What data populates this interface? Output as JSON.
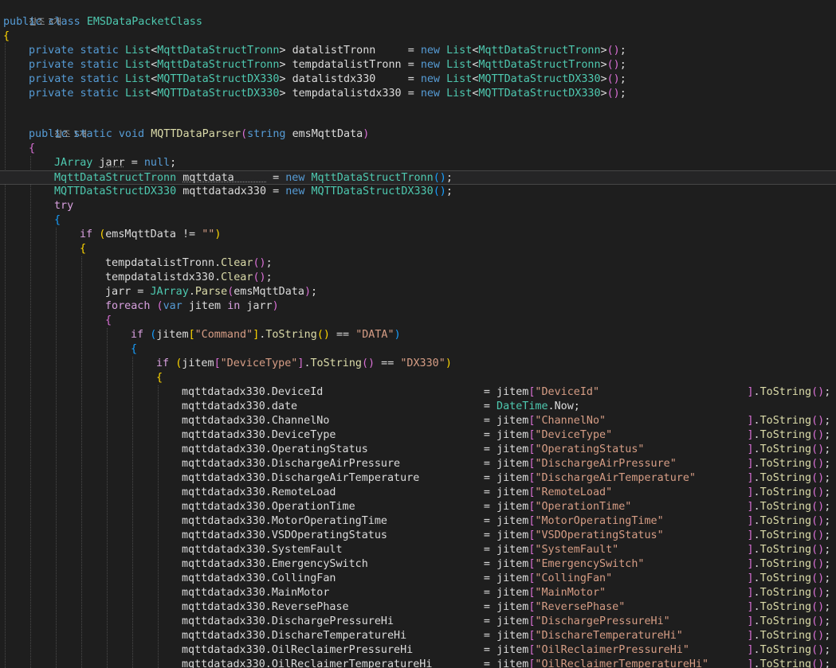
{
  "colors": {
    "background": "#1e1e1e",
    "keyword": "#569cd6",
    "control_keyword": "#d8a0df",
    "type": "#4ec9b0",
    "method": "#dcdcaa",
    "string": "#d69d85",
    "identifier": "#dcdcdc",
    "codelens": "#a0a0a0",
    "brace_level1": "#ffd700",
    "brace_level2": "#da70d6",
    "brace_level3": "#179fff"
  },
  "codelens": {
    "class_refs": "참조 3개",
    "method_refs": "참조 1개"
  },
  "code": {
    "class_decl": {
      "public": "public",
      "class": "class",
      "name": "EMSDataPacketClass"
    },
    "fields": [
      {
        "mods": "private static",
        "type": "List",
        "generic": "MqttDataStructTronn",
        "name": "datalistTronn     ",
        "new": "new",
        "init": "MqttDataStructTronn"
      },
      {
        "mods": "private static",
        "type": "List",
        "generic": "MqttDataStructTronn",
        "name": "tempdatalistTronn ",
        "new": "new",
        "init": "MqttDataStructTronn"
      },
      {
        "mods": "private static",
        "type": "List",
        "generic": "MQTTDataStructDX330",
        "name": "datalistdx330     ",
        "new": "new",
        "init": "MQTTDataStructDX330"
      },
      {
        "mods": "private static",
        "type": "List",
        "generic": "MQTTDataStructDX330",
        "name": "tempdatalistdx330 ",
        "new": "new",
        "init": "MQTTDataStructDX330"
      }
    ],
    "method_decl": {
      "mods": "public static void",
      "name": "MQTTDataParser",
      "param_type": "string",
      "param_name": "emsMqttData"
    },
    "locals": {
      "jarray_type": "JArray",
      "jarr": "jarr",
      "null": "null",
      "tronn_type": "MqttDataStructTronn",
      "tronn_var": "mqttdata     ",
      "tronn_new": "new",
      "tronn_init": "MqttDataStructTronn",
      "dx_type": "MQTTDataStructDX330",
      "dx_var": "mqttdatadx330",
      "dx_new": "new",
      "dx_init": "MQTTDataStructDX330"
    },
    "try_kw": "try",
    "if_kw": "if",
    "foreach_kw": "foreach",
    "var_kw": "var",
    "in_kw": "in",
    "jitem": "jitem",
    "empty_string": "\"\"",
    "clear": "Clear",
    "parse": "Parse",
    "to_string": "ToString",
    "command_key": "\"Command\"",
    "data_value": "\"DATA\"",
    "devicetype_key": "\"DeviceType\"",
    "dx330_value": "\"DX330\"",
    "now_type": "DateTime",
    "now_prop": "Now",
    "assignments": [
      {
        "prop": "DeviceId",
        "key": "\"DeviceId\""
      },
      {
        "prop": "date",
        "key": ""
      },
      {
        "prop": "ChannelNo",
        "key": "\"ChannelNo\""
      },
      {
        "prop": "DeviceType",
        "key": "\"DeviceType\""
      },
      {
        "prop": "OperatingStatus",
        "key": "\"OperatingStatus\""
      },
      {
        "prop": "DischargeAirPressure",
        "key": "\"DischargeAirPressure\""
      },
      {
        "prop": "DischargeAirTemperature",
        "key": "\"DischargeAirTemperature\""
      },
      {
        "prop": "RemoteLoad",
        "key": "\"RemoteLoad\""
      },
      {
        "prop": "OperationTime",
        "key": "\"OperationTime\""
      },
      {
        "prop": "MotorOperatingTime",
        "key": "\"MotorOperatingTime\""
      },
      {
        "prop": "VSDOperatingStatus",
        "key": "\"VSDOperatingStatus\""
      },
      {
        "prop": "SystemFault",
        "key": "\"SystemFault\""
      },
      {
        "prop": "EmergencySwitch",
        "key": "\"EmergencySwitch\""
      },
      {
        "prop": "CollingFan",
        "key": "\"CollingFan\""
      },
      {
        "prop": "MainMotor",
        "key": "\"MainMotor\""
      },
      {
        "prop": "ReversePhase",
        "key": "\"ReversePhase\""
      },
      {
        "prop": "DischargePressureHi",
        "key": "\"DischargePressureHi\""
      },
      {
        "prop": "DischareTemperatureHi",
        "key": "\"DischareTemperatureHi\""
      },
      {
        "prop": "OilReclaimerPressureHi",
        "key": "\"OilReclaimerPressureHi\""
      },
      {
        "prop": "OilReclaimerTemperatureHi",
        "key": "\"OilReclaimerTemperatureHi\""
      }
    ]
  }
}
